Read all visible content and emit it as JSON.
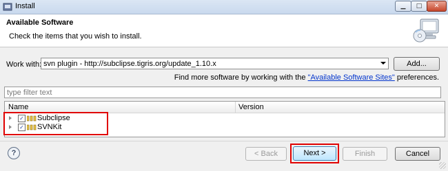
{
  "window": {
    "title": "Install",
    "controls": {
      "minimize": "▁",
      "maximize": "□",
      "close": "✕"
    }
  },
  "banner": {
    "heading": "Available Software",
    "subheading": "Check the items that you wish to install."
  },
  "work_with": {
    "label": "Work with:",
    "value": "svn plugin - http://subclipse.tigris.org/update_1.10.x",
    "add_label": "Add..."
  },
  "more_software": {
    "prefix": "Find more software by working with the ",
    "link": "\"Available Software Sites\"",
    "suffix": " preferences."
  },
  "filter": {
    "placeholder": "type filter text"
  },
  "table": {
    "columns": [
      "Name",
      "Version"
    ],
    "rows": [
      {
        "name": "Subclipse",
        "version": "",
        "checked": true,
        "expander": "collapsed"
      },
      {
        "name": "SVNKit",
        "version": "",
        "checked": true,
        "expander": "collapsed"
      }
    ]
  },
  "footer": {
    "help": "?",
    "back_label": "< Back",
    "next_label": "Next >",
    "finish_label": "Finish",
    "cancel_label": "Cancel"
  },
  "icons": {
    "app": "install-icon",
    "banner": "cd-computer-icon",
    "package": "package-icon",
    "help": "help-icon"
  },
  "colors": {
    "highlight": "#e00000",
    "link": "#0033cc"
  }
}
